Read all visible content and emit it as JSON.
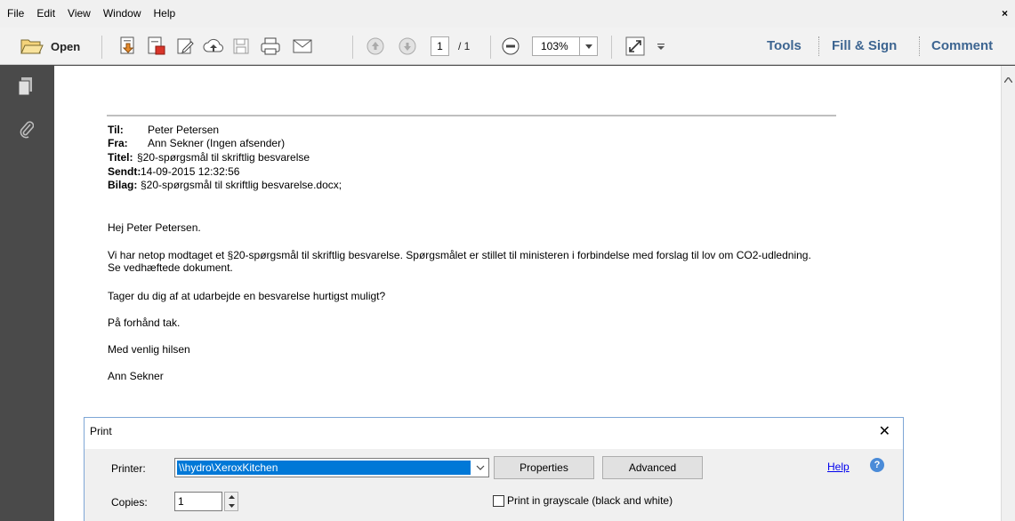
{
  "menu": {
    "items": [
      "File",
      "Edit",
      "View",
      "Window",
      "Help"
    ],
    "close": "×"
  },
  "toolbar": {
    "open_label": "Open",
    "page_current": "1",
    "page_total": "/ 1",
    "zoom": "103%",
    "tabs": [
      "Tools",
      "Fill & Sign",
      "Comment"
    ],
    "icons": [
      "folder-open-icon",
      "create-pdf-icon",
      "export-pdf-icon",
      "edit-pdf-icon",
      "cloud-upload-icon",
      "save-icon",
      "print-icon",
      "email-icon",
      "page-up-icon",
      "page-down-icon",
      "zoom-out-icon",
      "dropdown-icon",
      "fit-page-icon",
      "more-tools-icon"
    ]
  },
  "leftnav": {
    "icons": [
      "pages-icon",
      "attachments-icon"
    ]
  },
  "document": {
    "header": [
      {
        "key": "Til:",
        "value": "Peter Petersen"
      },
      {
        "key": "Fra:",
        "value": "Ann Sekner (Ingen afsender)"
      },
      {
        "key": "Titel:",
        "value": "§20-spørgsmål til skriftlig besvarelse"
      },
      {
        "key": "Sendt:",
        "value": "14-09-2015 12:32:56"
      },
      {
        "key": "Bilag:",
        "value": "§20-spørgsmål til skriftlig besvarelse.docx;"
      }
    ],
    "greeting": "Hej Peter Petersen.",
    "body_line1": "Vi har netop modtaget et §20-spørgsmål til skriftlig besvarelse. Spørgsmålet er stillet til ministeren i forbindelse med forslag til lov om CO2-udledning.",
    "body_line2": "Se vedhæftede dokument.",
    "request": "Tager du dig af at udarbejde en besvarelse hurtigst muligt?",
    "thanks": "På forhånd tak.",
    "closing": "Med venlig hilsen",
    "signature": "Ann Sekner"
  },
  "print_dialog": {
    "title": "Print",
    "close": "✕",
    "printer_label": "Printer:",
    "printer_value": "\\\\hydro\\XeroxKitchen",
    "properties_label": "Properties",
    "advanced_label": "Advanced",
    "help_label": "Help",
    "help_icon": "?",
    "copies_label": "Copies:",
    "copies_value": "1",
    "grayscale_label": "Print in grayscale (black and white)"
  }
}
